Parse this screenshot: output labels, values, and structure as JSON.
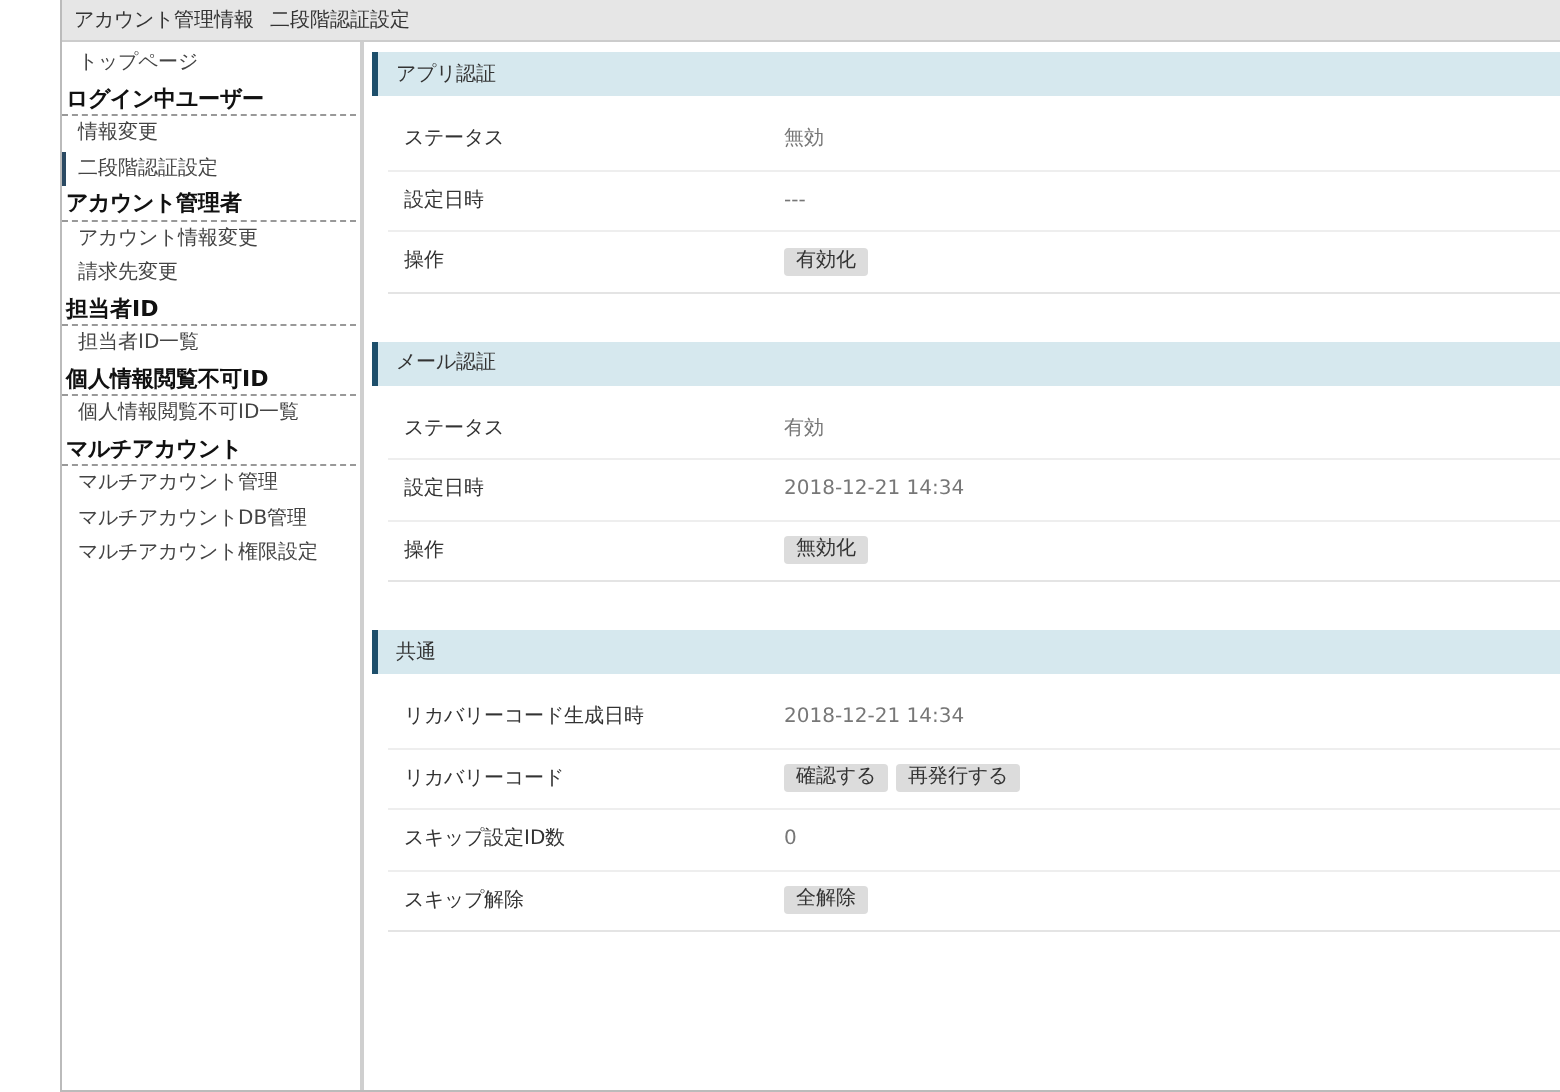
{
  "header": {
    "title": "アカウント管理情報",
    "subtitle": "二段階認証設定"
  },
  "sidebar": {
    "top_item": {
      "label": "トップページ",
      "selected": false
    },
    "groups": [
      {
        "title": "ログイン中ユーザー",
        "items": [
          {
            "label": "情報変更",
            "selected": false
          },
          {
            "label": "二段階認証設定",
            "selected": true
          }
        ]
      },
      {
        "title": "アカウント管理者",
        "items": [
          {
            "label": "アカウント情報変更",
            "selected": false
          },
          {
            "label": "請求先変更",
            "selected": false
          }
        ]
      },
      {
        "title": "担当者ID",
        "items": [
          {
            "label": "担当者ID一覧",
            "selected": false
          }
        ]
      },
      {
        "title": "個人情報閲覧不可ID",
        "items": [
          {
            "label": "個人情報閲覧不可ID一覧",
            "selected": false
          }
        ]
      },
      {
        "title": "マルチアカウント",
        "items": [
          {
            "label": "マルチアカウント管理",
            "selected": false
          },
          {
            "label": "マルチアカウントDB管理",
            "selected": false
          },
          {
            "label": "マルチアカウント権限設定",
            "selected": false
          }
        ]
      }
    ]
  },
  "sections": [
    {
      "title": "アプリ認証",
      "rows": [
        {
          "label": "ステータス",
          "kind": "text",
          "value": "無効"
        },
        {
          "label": "設定日時",
          "kind": "text",
          "value": "---"
        },
        {
          "label": "操作",
          "kind": "buttons",
          "buttons": [
            "有効化"
          ]
        }
      ]
    },
    {
      "title": "メール認証",
      "rows": [
        {
          "label": "ステータス",
          "kind": "text",
          "value": "有効"
        },
        {
          "label": "設定日時",
          "kind": "text",
          "value": "2018-12-21 14:34"
        },
        {
          "label": "操作",
          "kind": "buttons",
          "buttons": [
            "無効化"
          ]
        }
      ]
    },
    {
      "title": "共通",
      "rows": [
        {
          "label": "リカバリーコード生成日時",
          "kind": "text",
          "value": "2018-12-21 14:34"
        },
        {
          "label": "リカバリーコード",
          "kind": "buttons",
          "buttons": [
            "確認する",
            "再発行する"
          ]
        },
        {
          "label": "スキップ設定ID数",
          "kind": "text",
          "value": "0"
        },
        {
          "label": "スキップ解除",
          "kind": "buttons",
          "buttons": [
            "全解除"
          ]
        }
      ]
    }
  ]
}
